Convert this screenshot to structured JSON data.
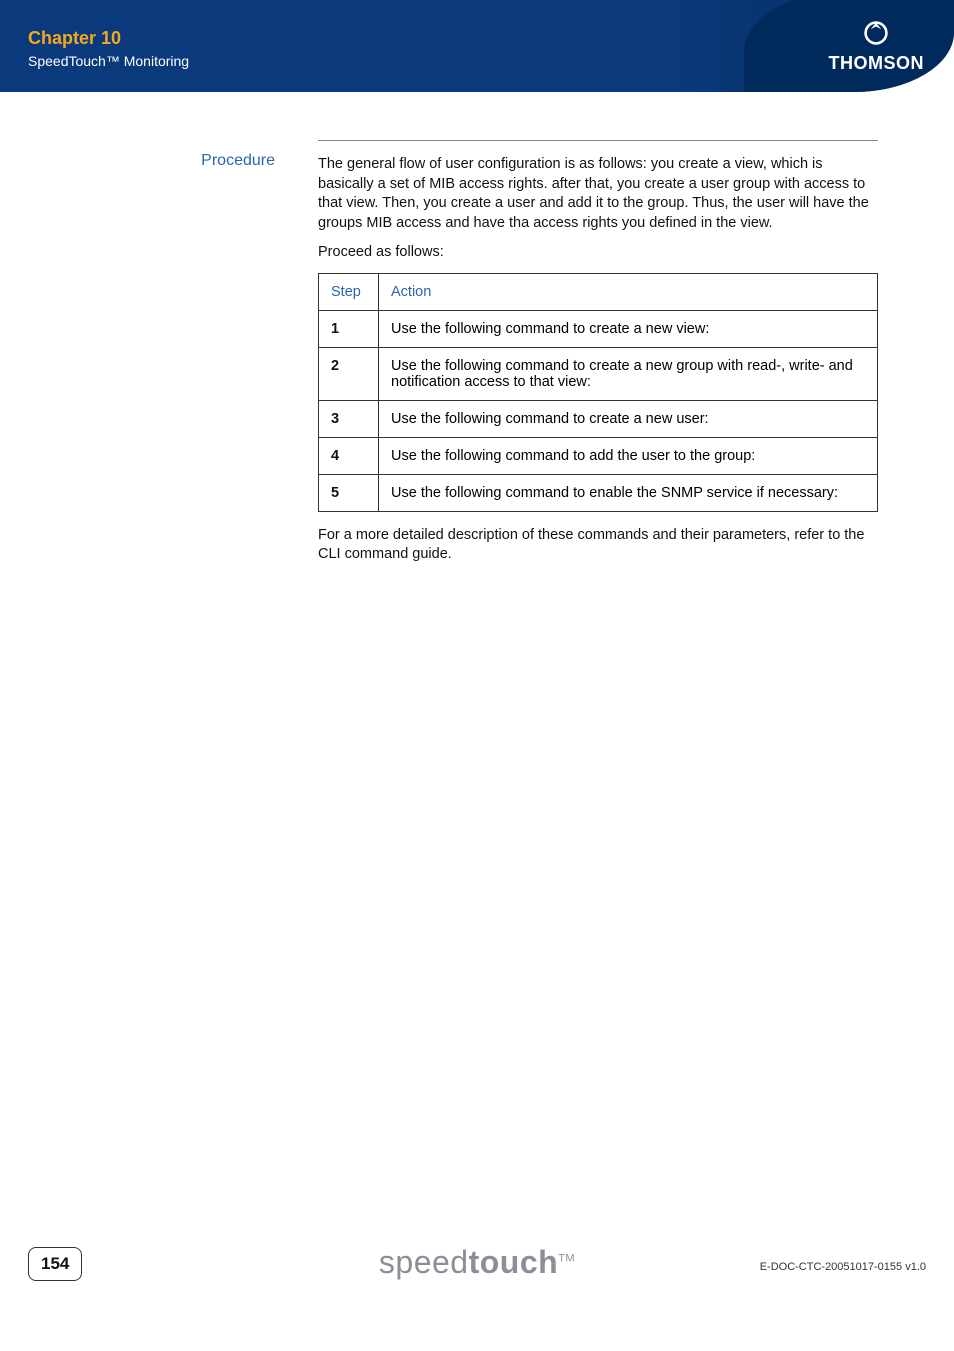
{
  "header": {
    "chapter_title": "Chapter 10",
    "chapter_subtitle": "SpeedTouch™ Monitoring",
    "brand": "THOMSON"
  },
  "section": {
    "label": "Procedure",
    "intro": "The general flow of user configuration is as follows: you create a view, which is basically a set of MIB access rights. after that, you create a user group with access to that view. Then, you create a user and add it to the group. Thus, the user will have the groups MIB access and have tha access rights you defined in the view.",
    "lead_in": "Proceed as follows:"
  },
  "table": {
    "col_step": "Step",
    "col_action": "Action",
    "rows": [
      {
        "step": "1",
        "action": "Use the following command to create a new view:"
      },
      {
        "step": "2",
        "action": "Use the following command to create a new group with read-, write- and notification access to that view:"
      },
      {
        "step": "3",
        "action": "Use the following command to create a new user:"
      },
      {
        "step": "4",
        "action": "Use the following command to add the user to the group:"
      },
      {
        "step": "5",
        "action": "Use the following command to enable the SNMP service if necessary:"
      }
    ]
  },
  "closing": "For a more detailed description of these commands and their parameters, refer to the CLI command guide.",
  "footer": {
    "page_num": "154",
    "brand_light": "speed",
    "brand_bold": "touch",
    "brand_tm": "TM",
    "doc_code": "E-DOC-CTC-20051017-0155 v1.0"
  }
}
